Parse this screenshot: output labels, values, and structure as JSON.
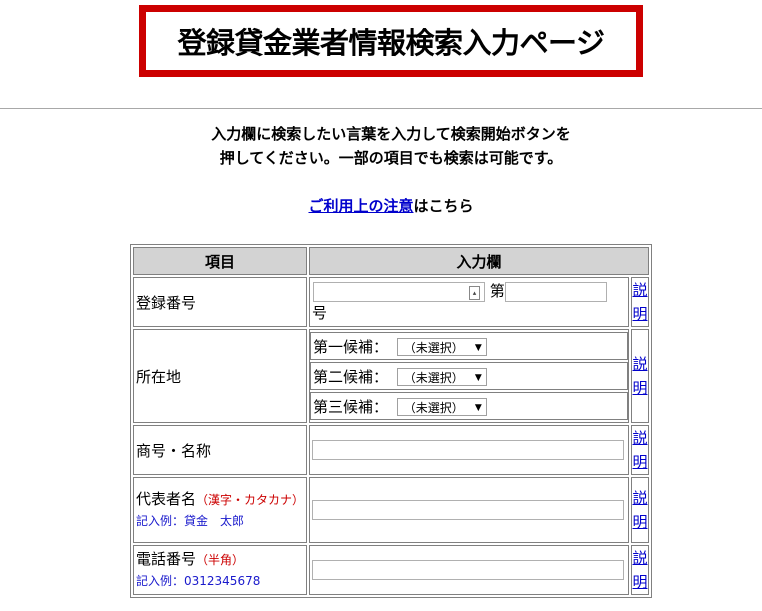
{
  "page_title": "登録貸金業者情報検索入力ページ",
  "intro": {
    "line1": "入力欄に検索したい言葉を入力して検索開始ボタンを",
    "line2": "押してください。一部の項目でも検索は可能です。"
  },
  "notice": {
    "link_text": "ご利用上の注意",
    "suffix": "はこちら"
  },
  "table": {
    "headers": {
      "item": "項目",
      "input": "入力欄"
    },
    "desc_label": {
      "top": "説",
      "bottom": "明"
    },
    "registration": {
      "label": "登録番号",
      "prefix": "第",
      "suffix": "号"
    },
    "address": {
      "label": "所在地",
      "candidates": [
        {
          "label": "第一候補：",
          "value": "（未選択）"
        },
        {
          "label": "第二候補：",
          "value": "（未選択）"
        },
        {
          "label": "第三候補：",
          "value": "（未選択）"
        }
      ]
    },
    "trade_name": {
      "label": "商号・名称"
    },
    "representative": {
      "label": "代表者名",
      "note": "（漢字・カタカナ）",
      "example": "記入例：貸金　太郎"
    },
    "phone": {
      "label": "電話番号",
      "note": "（半角）",
      "example": "記入例：0312345678"
    }
  },
  "colors": {
    "title_border": "#cc0000",
    "link": "#0000cc",
    "header_bg": "#d3d3d3"
  }
}
